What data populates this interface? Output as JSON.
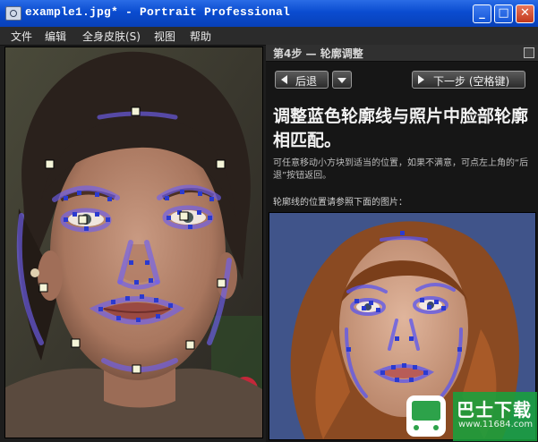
{
  "window": {
    "title": "example1.jpg* - Portrait Professional",
    "minimize": "_",
    "maximize": "□",
    "close": "✕"
  },
  "menu": {
    "file": "文件",
    "edit": "编辑",
    "skin": "全身皮肤(S)",
    "view": "视图",
    "help": "帮助"
  },
  "panel": {
    "step_title": "第4步 — 轮廓调整",
    "back_button": "后退",
    "next_button": "下一步 (空格键)",
    "heading": "调整蓝色轮廓线与照片中脸部轮廓相匹配。",
    "description": "可任意移动小方块到适当的位置，如果不满意，可点左上角的“后退”按钮返回。",
    "reference_label": "轮廓线的位置请参照下面的图片："
  },
  "watermark": {
    "title": "巴士下载",
    "url": "www.11684.com"
  }
}
